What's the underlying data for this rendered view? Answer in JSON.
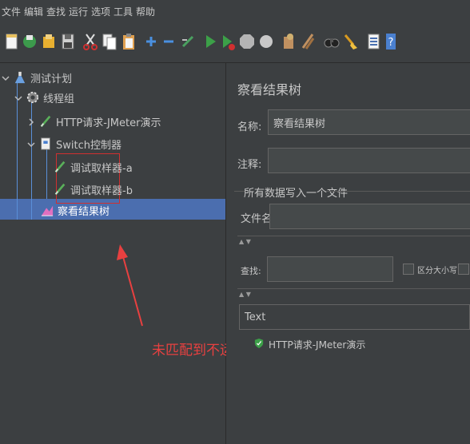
{
  "menubar": {
    "items": [
      "文件",
      "编辑",
      "查找",
      "运行",
      "选项",
      "工具",
      "帮助"
    ]
  },
  "toolbar": {
    "buttons": [
      "new-icon",
      "templates-icon",
      "open-icon",
      "save-icon",
      "cut-icon",
      "copy-icon",
      "paste-icon",
      "expand-icon",
      "collapse-icon",
      "toggle-icon",
      "start-icon",
      "start-no-pause-icon",
      "stop-icon",
      "shutdown-icon",
      "clear-icon",
      "clear-all-icon",
      "search-icon",
      "reset-search-icon",
      "function-helper-icon",
      "help-icon"
    ]
  },
  "tree": {
    "test_plan": "测试计划",
    "thread_group": "线程组",
    "http_request": "HTTP请求-JMeter演示",
    "switch_controller": "Switch控制器",
    "debug_sampler_a": "调试取样器-a",
    "debug_sampler_b": "调试取样器-b",
    "view_results_tree": "察看结果树"
  },
  "annotation": {
    "text": "未匹配到不运行",
    "color": "#e84040"
  },
  "panel": {
    "title": "察看结果树",
    "name_label": "名称:",
    "name_value": "察看结果树",
    "comment_label": "注释:",
    "comment_value": "",
    "file_section": "所有数据写入一个文件",
    "filename_label": "文件名",
    "filename_value": "",
    "search_label": "查找:",
    "search_value": "",
    "case_sensitive_label": "区分大小写",
    "renderer_value": "Text",
    "result_item": "HTTP请求-JMeter演示"
  },
  "colors": {
    "background": "#3c3f41",
    "selected": "#4b6eaf",
    "annotation_red": "#e84040"
  }
}
